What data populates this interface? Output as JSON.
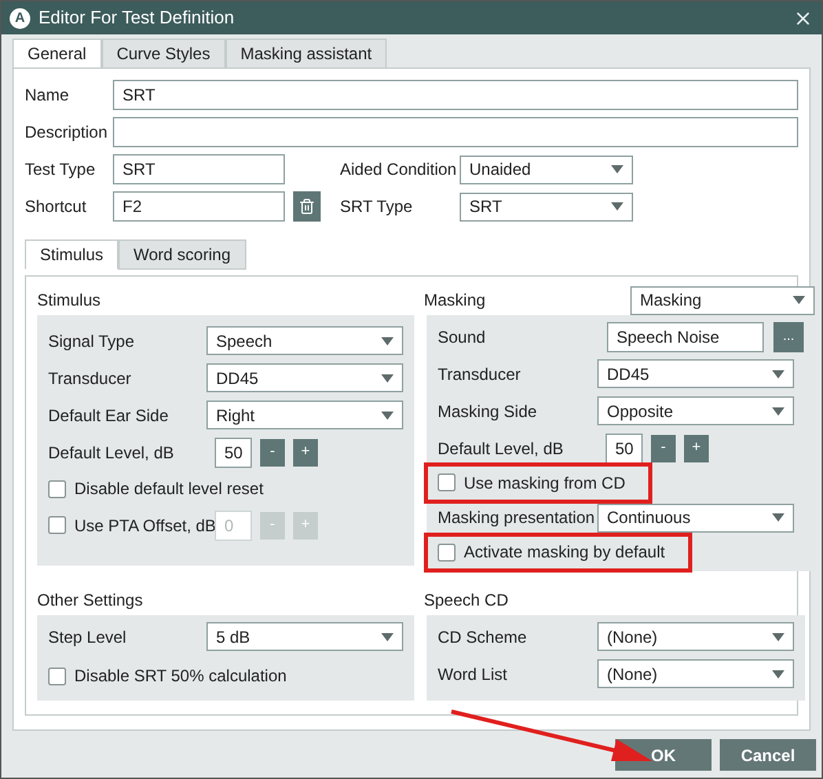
{
  "window": {
    "logo": "A",
    "title": "Editor For Test Definition"
  },
  "tabs": [
    {
      "label": "General",
      "selected": true
    },
    {
      "label": "Curve Styles",
      "selected": false
    },
    {
      "label": "Masking assistant",
      "selected": false
    }
  ],
  "general": {
    "name": {
      "label": "Name",
      "value": "SRT"
    },
    "description": {
      "label": "Description"
    },
    "test_type": {
      "label": "Test Type",
      "value": "SRT"
    },
    "aided_condition": {
      "label": "Aided Condition",
      "value": "Unaided"
    },
    "shortcut": {
      "label": "Shortcut",
      "value": "F2"
    },
    "srt_type": {
      "label": "SRT Type",
      "value": "SRT"
    }
  },
  "inner_tabs": [
    {
      "label": "Stimulus",
      "selected": true
    },
    {
      "label": "Word scoring",
      "selected": false
    }
  ],
  "stimulus": {
    "title": "Stimulus",
    "rows": [
      {
        "kind": "select",
        "label": "Signal Type",
        "value": "Speech"
      },
      {
        "kind": "select",
        "label": "Transducer",
        "value": "DD45"
      },
      {
        "kind": "select",
        "label": "Default Ear Side",
        "value": "Right"
      },
      {
        "kind": "stepper",
        "label": "Default Level, dB",
        "value": "50",
        "decrement": "-",
        "increment": "+",
        "disabled": false
      },
      {
        "kind": "checkbox",
        "label": "Disable default level reset",
        "checked": false,
        "highlighted": false
      },
      {
        "kind": "checkbox_stepper",
        "label": "Use PTA Offset, dB",
        "checked": false,
        "value": "0",
        "decrement": "-",
        "increment": "+",
        "disabled": true
      }
    ]
  },
  "masking": {
    "title": "Masking",
    "mode": "Masking",
    "rows": [
      {
        "kind": "browse",
        "label": "Sound",
        "value": "Speech Noise",
        "button": "..."
      },
      {
        "kind": "select",
        "label": "Transducer",
        "value": "DD45"
      },
      {
        "kind": "select",
        "label": "Masking Side",
        "value": "Opposite"
      },
      {
        "kind": "stepper",
        "label": "Default Level, dB",
        "value": "50",
        "decrement": "-",
        "increment": "+",
        "disabled": false
      },
      {
        "kind": "checkbox",
        "label": "Use masking from CD",
        "checked": false,
        "highlighted": true
      },
      {
        "kind": "select",
        "label": "Masking presentation",
        "value": "Continuous"
      },
      {
        "kind": "checkbox",
        "label": "Activate masking by default",
        "checked": false,
        "highlighted": true
      }
    ]
  },
  "other_settings": {
    "title": "Other Settings",
    "rows": [
      {
        "kind": "select",
        "label": "Step Level",
        "value": "5 dB"
      },
      {
        "kind": "checkbox",
        "label": "Disable SRT 50% calculation",
        "checked": false,
        "highlighted": false
      }
    ]
  },
  "speech_cd": {
    "title": "Speech CD",
    "rows": [
      {
        "kind": "select",
        "label": "CD Scheme",
        "value": "(None)"
      },
      {
        "kind": "select",
        "label": "Word List",
        "value": "(None)"
      }
    ]
  },
  "buttons": [
    {
      "label": "OK"
    },
    {
      "label": "Cancel"
    }
  ]
}
